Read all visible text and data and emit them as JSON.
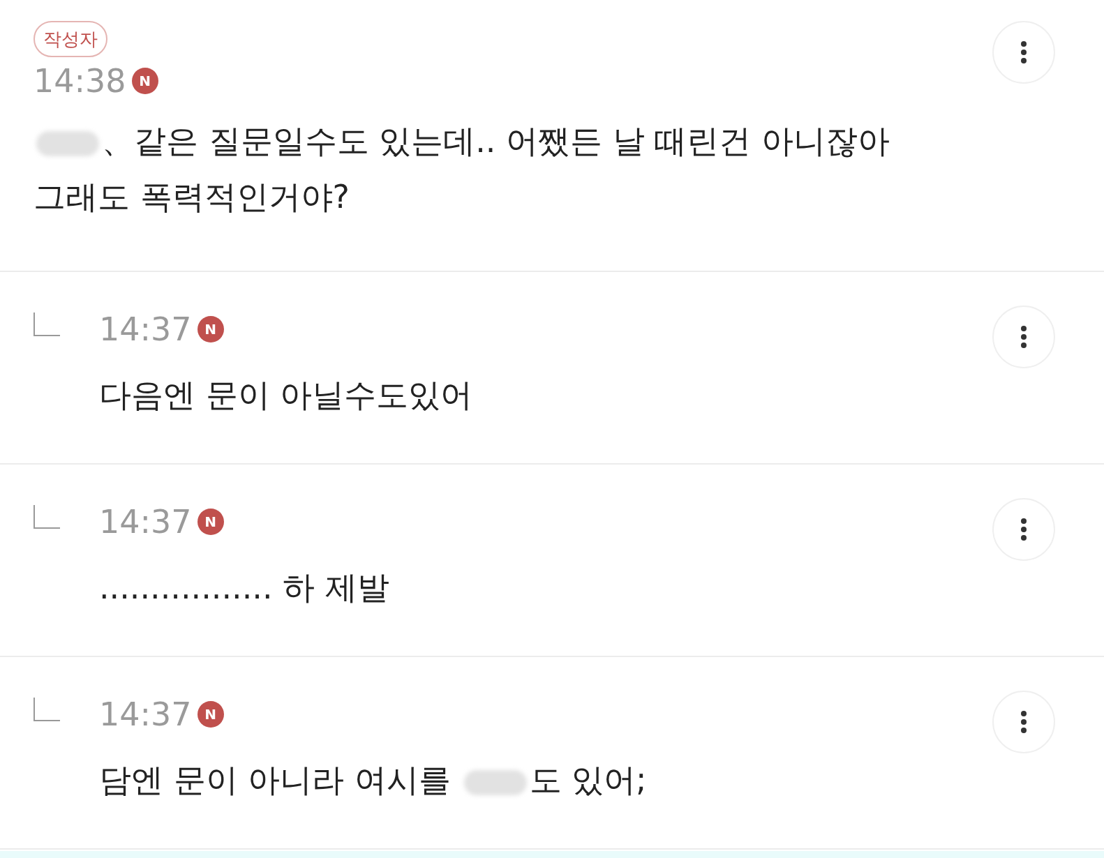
{
  "comments": [
    {
      "kind": "post",
      "author_badge": "작성자",
      "time": "14:38",
      "new_badge": "N",
      "segments": [
        {
          "kind": "blur"
        },
        {
          "kind": "text",
          "text": "、같은 질문일수도 있는데.. 어쨌든 날 때린건 아니잖아 그래도 폭력적인거야?"
        }
      ]
    },
    {
      "kind": "reply",
      "time": "14:37",
      "new_badge": "N",
      "segments": [
        {
          "kind": "text",
          "text": "다음엔 문이 아닐수도있어"
        }
      ]
    },
    {
      "kind": "reply",
      "time": "14:37",
      "new_badge": "N",
      "segments": [
        {
          "kind": "text",
          "text": "................. 하 제발"
        }
      ]
    },
    {
      "kind": "reply",
      "time": "14:37",
      "new_badge": "N",
      "segments": [
        {
          "kind": "text",
          "text": "담엔 문이 아니라 여시를 "
        },
        {
          "kind": "blur"
        },
        {
          "kind": "text",
          "text": "도 있어;"
        }
      ]
    }
  ]
}
